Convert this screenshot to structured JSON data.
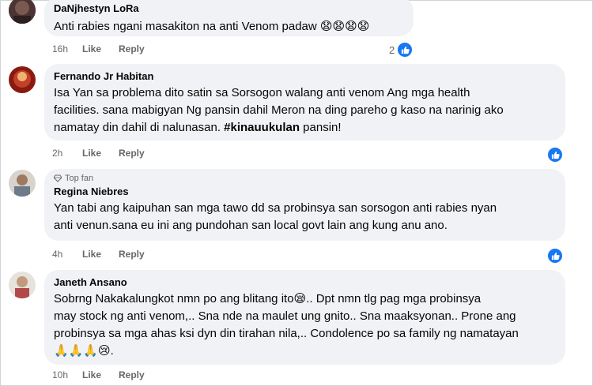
{
  "comments": [
    {
      "name": "DaNjhestyn LoRa",
      "text": "Anti rabies ngani masakiton na anti Venom padaw",
      "emoji": "😧😧😧😧",
      "time": "16h",
      "like_label": "Like",
      "reply_label": "Reply",
      "reaction_count": "2"
    },
    {
      "name": "Fernando Jr Habitan",
      "text_lines": [
        "Isa Yan sa problema dito satin sa Sorsogon walang anti venom Ang mga health",
        "facilities. sana mabigyan Ng pansin dahil Meron na ding pareho g kaso na narinig ako",
        "namatay din dahil di nalunasan."
      ],
      "hashtag": "#kinauukulan",
      "after_hashtag": " pansin!",
      "time": "2h",
      "like_label": "Like",
      "reply_label": "Reply"
    },
    {
      "badge": "Top fan",
      "name": "Regina Niebres",
      "text_lines": [
        "Yan tabi ang kaipuhan san mga tawo dd sa probinsya san sorsogon anti rabies nyan",
        "anti venun.sana eu ini ang pundohan san local govt lain ang kung anu ano."
      ],
      "time": "4h",
      "like_label": "Like",
      "reply_label": "Reply"
    },
    {
      "name": "Janeth Ansano",
      "line1_before": "Sobrng Nakakalungkot nmn po ang blitang ito",
      "line1_emoji": "😪",
      "line1_after": ".. Dpt nmn tlg pag mga probinsya",
      "text_lines": [
        "may stock ng anti venom,.. Sna nde na maulet ung gnito.. Sna maaksyonan.. Prone ang",
        "probinsya sa mga ahas ksi dyn din tirahan nila,.. Condolence po sa family ng namatayan"
      ],
      "last_emoji": "🙏🙏🙏😢",
      "last_after": ".",
      "time": "10h",
      "like_label": "Like",
      "reply_label": "Reply"
    }
  ]
}
